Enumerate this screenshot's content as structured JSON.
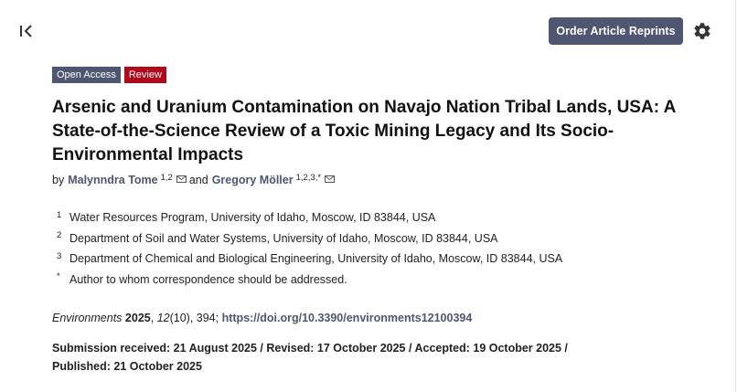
{
  "toolbar": {
    "reprints_label": "Order Article Reprints"
  },
  "badges": {
    "open_access": "Open Access",
    "type": "Review"
  },
  "article": {
    "title": "Arsenic and Uranium Contamination on Navajo Nation Tribal Lands, USA: A State-of-the-Science Review of a Toxic Mining Legacy and Its Socio-Environmental Impacts",
    "by": "by",
    "and": "and",
    "authors": [
      {
        "name": "Malynndra Tome",
        "affil": "1,2"
      },
      {
        "name": "Gregory Möller",
        "affil": "1,2,3,*"
      }
    ],
    "affiliations": [
      {
        "num": "1",
        "text": "Water Resources Program, University of Idaho, Moscow, ID 83844, USA"
      },
      {
        "num": "2",
        "text": "Department of Soil and Water Systems, University of Idaho, Moscow, ID 83844, USA"
      },
      {
        "num": "3",
        "text": "Department of Chemical and Biological Engineering, University of Idaho, Moscow, ID 83844, USA"
      },
      {
        "num": "*",
        "text": "Author to whom correspondence should be addressed."
      }
    ],
    "citation": {
      "journal": "Environments",
      "year": "2025",
      "volume": "12",
      "issue": "(10)",
      "page": ", 394;",
      "doi": "https://doi.org/10.3390/environments12100394"
    },
    "dates_line1": "Submission received: 21 August 2025 / Revised: 17 October 2025 / Accepted: 19 October 2025 /",
    "dates_line2": "Published: 21 October 2025"
  },
  "icons": {
    "collapse": "collapse-left-icon",
    "settings": "gear-icon",
    "email": "envelope-icon"
  },
  "colors": {
    "primary": "#4f5671",
    "review_badge": "#b3081b"
  }
}
